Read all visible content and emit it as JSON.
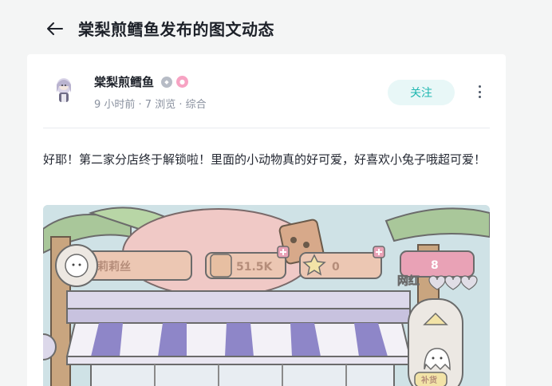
{
  "header": {
    "title": "棠梨煎鳕鱼发布的图文动态"
  },
  "author": {
    "name": "棠梨煎鳕鱼",
    "meta": "9 小时前 · 7 浏览 · 综合"
  },
  "actions": {
    "follow_label": "关注"
  },
  "post": {
    "text": "好耶！第二家分店终于解锁啦！里面的小动物真的好可爱，好喜欢小兔子哦超可爱！"
  },
  "game_hud": {
    "player_name": "莉莉丝",
    "currency": "51.5K",
    "stars": "0",
    "level": "8",
    "fame_label": "网红",
    "side_label": "补货"
  },
  "colors": {
    "follow_bg": "#e8f7f7",
    "follow_text": "#1fb7b0",
    "awning_purple": "#8e86c8",
    "hud_panel": "#ecc7b3"
  }
}
